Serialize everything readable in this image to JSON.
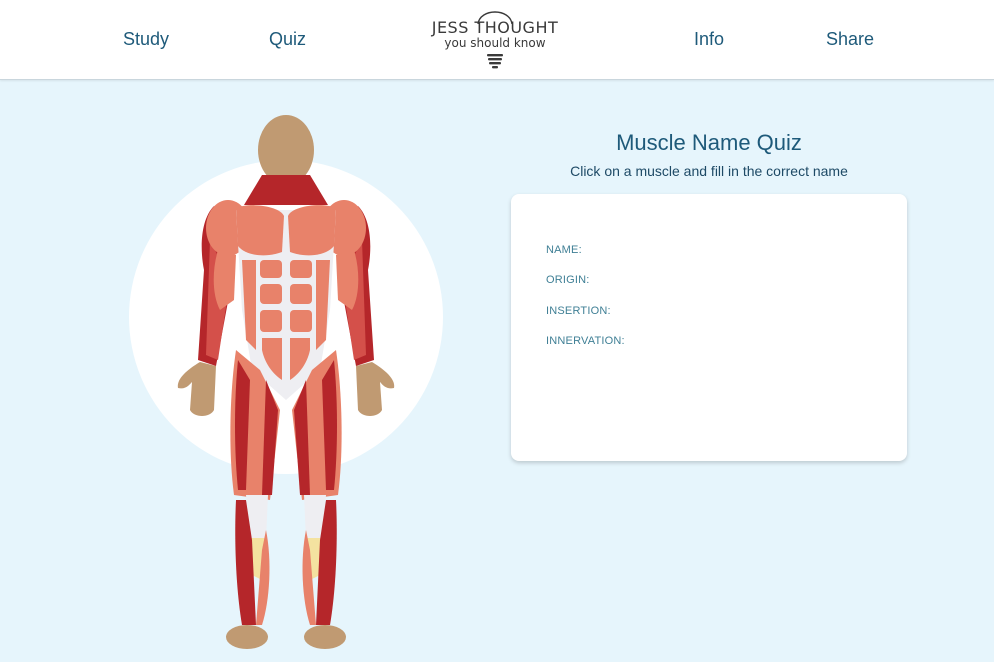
{
  "nav": {
    "study": "Study",
    "quiz": "Quiz",
    "info": "Info",
    "share": "Share"
  },
  "logo": {
    "line1": "JESS THOUGHT",
    "line2": "you should know"
  },
  "quiz": {
    "title": "Muscle Name Quiz",
    "subtitle": "Click on a muscle and fill in the correct name",
    "fields": {
      "name": "NAME:",
      "origin": "ORIGIN:",
      "insertion": "INSERTION:",
      "innervation": "INNERVATION:"
    }
  },
  "colors": {
    "background": "#e6f5fc",
    "accent": "#1e5a7a",
    "muscle_light": "#e8826a",
    "muscle_dark": "#b5262a",
    "skin": "#c09a72"
  }
}
